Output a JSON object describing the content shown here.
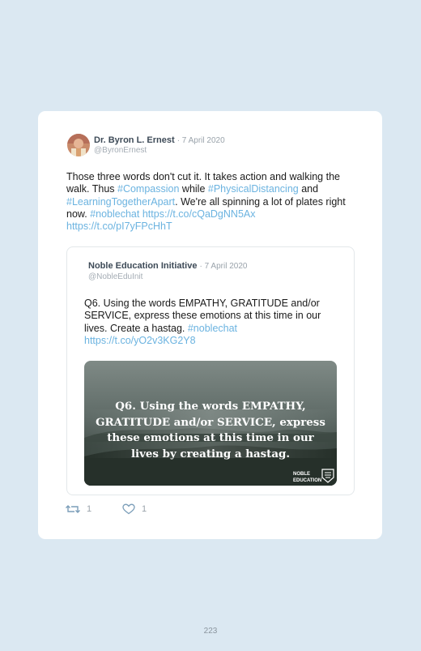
{
  "tweet": {
    "author_name": "Dr. Byron L. Ernest",
    "date": "· 7 April 2020",
    "handle": "@ByronErnest",
    "text_parts": [
      "Those three words don't cut it. It takes action and walking the walk. Thus ",
      "#Compassion",
      " while ",
      "#PhysicalDistancing",
      " and ",
      "#LearningTogetherApart",
      ". We're all spinning a lot of plates right now. ",
      "#noblechat",
      " ",
      "https://t.co/cQaDgNN5Ax",
      " ",
      "https://t.co/pI7yFPcHhT"
    ],
    "retweet_count": "1",
    "like_count": "1"
  },
  "quoted": {
    "author_name": "Noble Education Initiative",
    "date": "· 7 April 2020",
    "handle": "@NobleEduInit",
    "text_parts": [
      "Q6. Using the words EMPATHY, GRATITUDE and/or SERVICE, express these emotions at this time in our lives. Create a hastag. ",
      "#noblechat",
      " ",
      "https://t.co/yO2v3KG2Y8"
    ],
    "image_caption": "Q6. Using the words EMPATHY, GRATITUDE and/or SERVICE, express these emotions at this time in our lives by creating a hastag.",
    "image_logo": "NOBLE EDUCATION"
  },
  "icons": {
    "retweet": "retweet-icon",
    "like": "heart-icon"
  },
  "colors": {
    "background": "#dbe8f2",
    "link": "#6bb3e0",
    "card": "#ffffff"
  },
  "page_number": "223"
}
